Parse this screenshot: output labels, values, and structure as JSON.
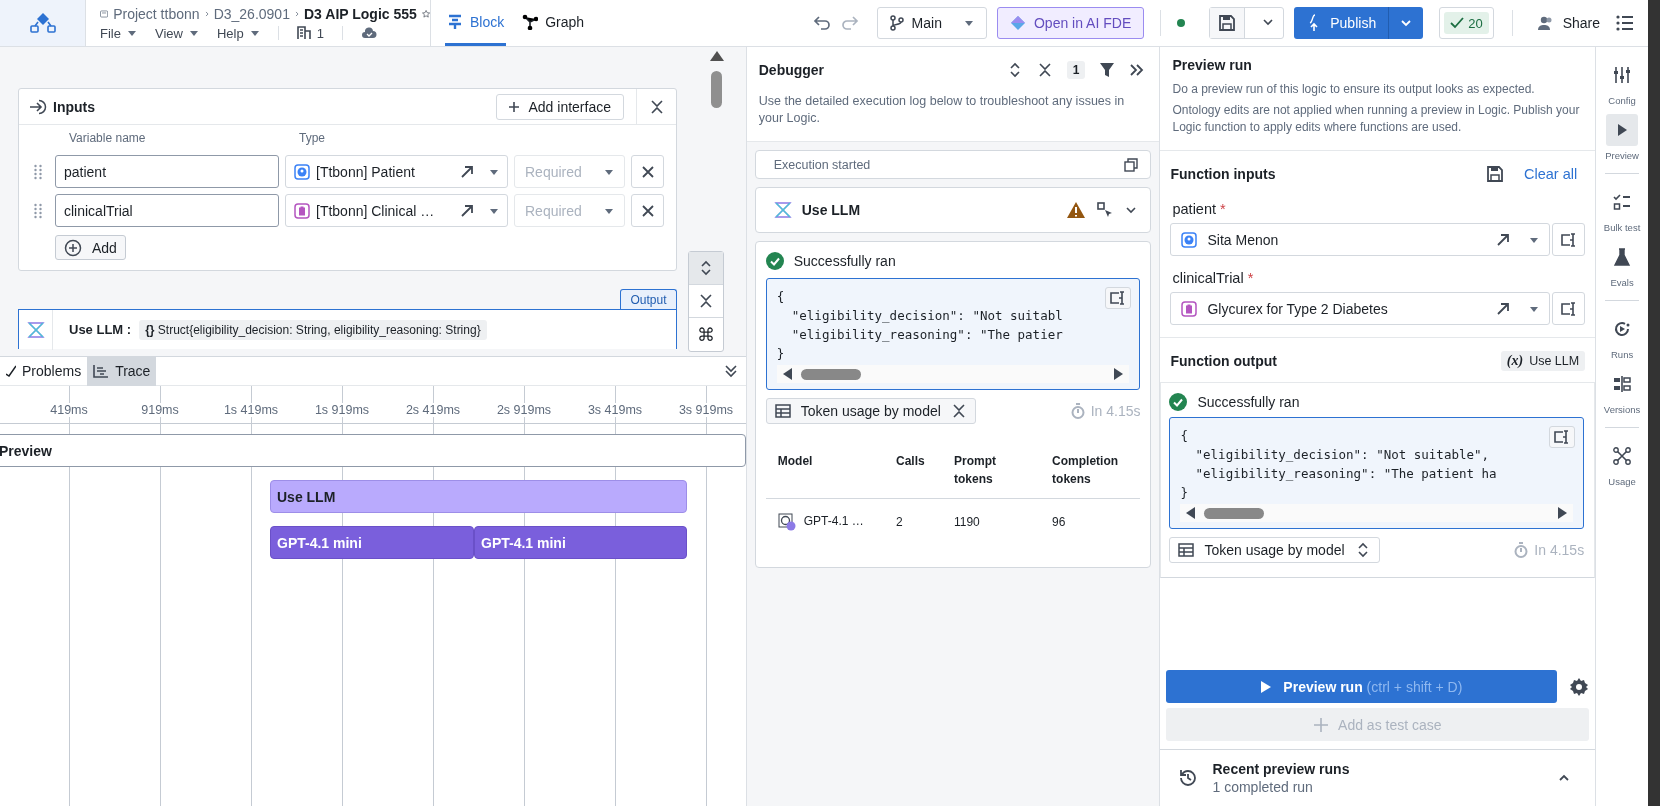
{
  "header": {
    "breadcrumb": [
      "Project ttbonn",
      "D3_26.0901"
    ],
    "title": "D3 AIP Logic 555",
    "menus": [
      "File",
      "View",
      "Help"
    ],
    "count": "1"
  },
  "view_tabs": [
    {
      "label": "Block",
      "selected": true,
      "kind": "block"
    },
    {
      "label": "Graph",
      "selected": false,
      "kind": "graph"
    }
  ],
  "toolbar": {
    "branch": "Main",
    "open_fde": "Open in AI FDE",
    "publish": "Publish",
    "checks": "20",
    "share": "Share"
  },
  "inputs": {
    "title": "Inputs",
    "add_interface": "Add interface",
    "columns": [
      "Variable name",
      "Type"
    ],
    "add": "Add",
    "rows": [
      {
        "name": "patient",
        "type": "[Ttbonn] Patient",
        "color": "#3b82f6",
        "requirement": "Required"
      },
      {
        "name": "clinicalTrial",
        "type": "[Ttbonn] Clinical …",
        "color": "#b455c0",
        "requirement": "Required"
      }
    ]
  },
  "canvas": {
    "shortcut_key": "⌘"
  },
  "output": {
    "tag": "Output",
    "label": "Use LLM :",
    "type_icon": "{}",
    "type": "Struct{eligibility_decision: String, eligibility_reasoning: String}"
  },
  "trace": {
    "tabs": [
      {
        "label": "Problems",
        "selected": false
      },
      {
        "label": "Trace",
        "selected": true
      }
    ],
    "ticks": [
      "419ms",
      "919ms",
      "1s 419ms",
      "1s 919ms",
      "2s 419ms",
      "2s 919ms",
      "3s 419ms",
      "3s 919ms"
    ],
    "spans": [
      {
        "label": "Preview",
        "kind": "root"
      },
      {
        "label": "Use LLM",
        "kind": "block"
      },
      {
        "label": "GPT-4.1 mini",
        "kind": "model"
      },
      {
        "label": "GPT-4.1 mini",
        "kind": "model"
      }
    ]
  },
  "debugger": {
    "title": "Debugger",
    "count": "1",
    "description": "Use the detailed execution log below to troubleshoot any issues in your Logic.",
    "execution": "Execution started",
    "block": "Use LLM",
    "warning": true,
    "status": "Successfully ran",
    "code": [
      "{",
      "  \"eligibility_decision\": \"Not suitabl",
      "  \"eligibility_reasoning\": \"The patier",
      "}"
    ],
    "token_toggle": "Token usage by model",
    "duration": "In 4.15s",
    "columns": [
      "Model",
      "Calls",
      "Prompt tokens",
      "Completion tokens"
    ],
    "rows": [
      [
        "GPT-4.1 …",
        "2",
        "1190",
        "96"
      ]
    ]
  },
  "preview": {
    "title": "Preview run",
    "description": [
      "Do a preview run of this logic to ensure its output looks as expected.",
      "Ontology edits are not applied when running a preview in Logic. Publish your Logic function to apply edits where functions are used."
    ],
    "inputs_title": "Function inputs",
    "clear_all": "Clear all",
    "inputs": [
      {
        "label": "patient",
        "required_mark": "*",
        "value": "Sita Menon",
        "color": "#3b82f6"
      },
      {
        "label": "clinicalTrial",
        "required_mark": "*",
        "value": "Glycurex for Type 2 Diabetes",
        "color": "#b455c0"
      }
    ],
    "output_title": "Function output",
    "output_ref_icon": "(x)",
    "output_ref": "Use LLM",
    "status": "Successfully ran",
    "code": [
      "{",
      "  \"eligibility_decision\": \"Not suitable\",",
      "  \"eligibility_reasoning\": \"The patient ha",
      "}"
    ],
    "token_toggle": "Token usage by model",
    "duration": "In 4.15s",
    "run_button": "Preview run",
    "shortcut": "(ctrl + shift + D)",
    "add_test": "Add as test case",
    "add_test_disabled": true,
    "recent_title": "Recent preview runs",
    "recent_count": "1 completed run"
  },
  "rail": [
    {
      "label": "Config",
      "kind": "config",
      "selected": false
    },
    {
      "label": "Preview",
      "kind": "preview",
      "selected": true
    },
    {
      "label": "Bulk test",
      "kind": "bulk",
      "selected": false
    },
    {
      "label": "Evals",
      "kind": "evals",
      "selected": false
    },
    {
      "label": "Runs",
      "kind": "runs",
      "selected": false
    },
    {
      "label": "Versions",
      "kind": "versions",
      "selected": false
    },
    {
      "label": "Usage",
      "kind": "usage",
      "selected": false
    }
  ]
}
